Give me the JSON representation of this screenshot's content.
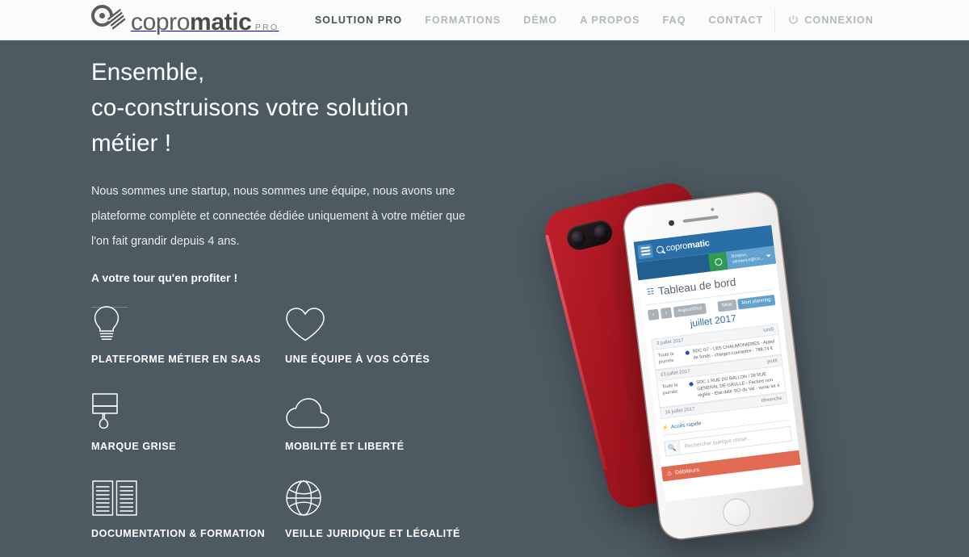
{
  "header": {
    "logo": {
      "word_light": "copro",
      "word_bold": "matic",
      "sub": "PRO"
    },
    "nav": [
      {
        "label": "SOLUTION PRO",
        "active": true
      },
      {
        "label": "FORMATIONS",
        "active": false
      },
      {
        "label": "DÉMO",
        "active": false
      },
      {
        "label": "A PROPOS",
        "active": false
      },
      {
        "label": "FAQ",
        "active": false
      },
      {
        "label": "CONTACT",
        "active": false
      }
    ],
    "login_label": "CONNEXION",
    "login_icon": "power-icon"
  },
  "hero": {
    "headline_lines": [
      "Ensemble,",
      "co-construisons votre solution",
      "métier !"
    ],
    "paragraph": "Nous sommes une startup, nous sommes une équipe, nous avons une plateforme complète et connectée dédiée uniquement à votre métier que l'on fait grandir depuis 4 ans.",
    "call_to_action": "A votre tour qu'en profiter !"
  },
  "features": [
    {
      "icon": "lightbulb-icon",
      "label": "PLATEFORME MÉTIER EN SAAS"
    },
    {
      "icon": "heart-icon",
      "label": "UNE ÉQUIPE À VOS CÔTÉS"
    },
    {
      "icon": "paintbrush-icon",
      "label": "MARQUE GRISE"
    },
    {
      "icon": "cloud-icon",
      "label": "MOBILITÉ ET LIBERTÉ"
    },
    {
      "icon": "open-book-icon",
      "label": "DOCUMENTATION & FORMATION"
    },
    {
      "icon": "globe-icon",
      "label": "VEILLE JURIDIQUE ET LÉGALITÉ"
    }
  ],
  "phone_app": {
    "brand_light": "copro",
    "brand_bold": "matic",
    "menu_icon": "hamburger-icon",
    "status_icon": "status-circle-icon",
    "user_line1": "Bonjour,",
    "user_line2": "clemence@co...",
    "page_icon": "dashboard-icon",
    "page_title": "Tableau de bord",
    "prev_label": "‹",
    "next_label": "›",
    "today_label": "Aujourd'hui",
    "month_toggle": "Mois",
    "planning_toggle": "Mon planning",
    "current_month": "juillet 2017",
    "events": [
      {
        "date": "3 juillet 2017",
        "weekday": "lundi",
        "when": "Toute la journée",
        "text": "SDC G7 - LES CHAUMONIERES - Appel de fonds - charges courantes - 788,74 €"
      },
      {
        "date": "13 juillet 2017",
        "weekday": "jeudi",
        "when": "Toute la journée",
        "text": "SDC 1 RUE DU BALLON / 28 RUE GENERAL DE GAULLE - Facture non réglée - Etat daté SCI du Val - vente lot 4"
      },
      {
        "date": "16 juillet 2017",
        "weekday": "dimanche",
        "when": "",
        "text": ""
      }
    ],
    "quick_access_label": "Accès rapide",
    "quick_access_icon": "bolt-icon",
    "search_icon": "magnifier-icon",
    "search_placeholder": "Rechercher quelque chose..",
    "alert_label": "Débiteurs",
    "alert_icon": "warning-icon"
  },
  "colors": {
    "page_background": "#4d5a61",
    "header_background": "#fafbfb",
    "nav_active": "#4b5157",
    "nav_inactive": "#b3b7bb",
    "app_blue": "#2a6ea8",
    "app_blue_dark": "#225f91",
    "app_blue_light": "#63a2cf",
    "app_green": "#2e9a52",
    "alert_red": "#e06a52",
    "phone_red": "#a3151f"
  }
}
